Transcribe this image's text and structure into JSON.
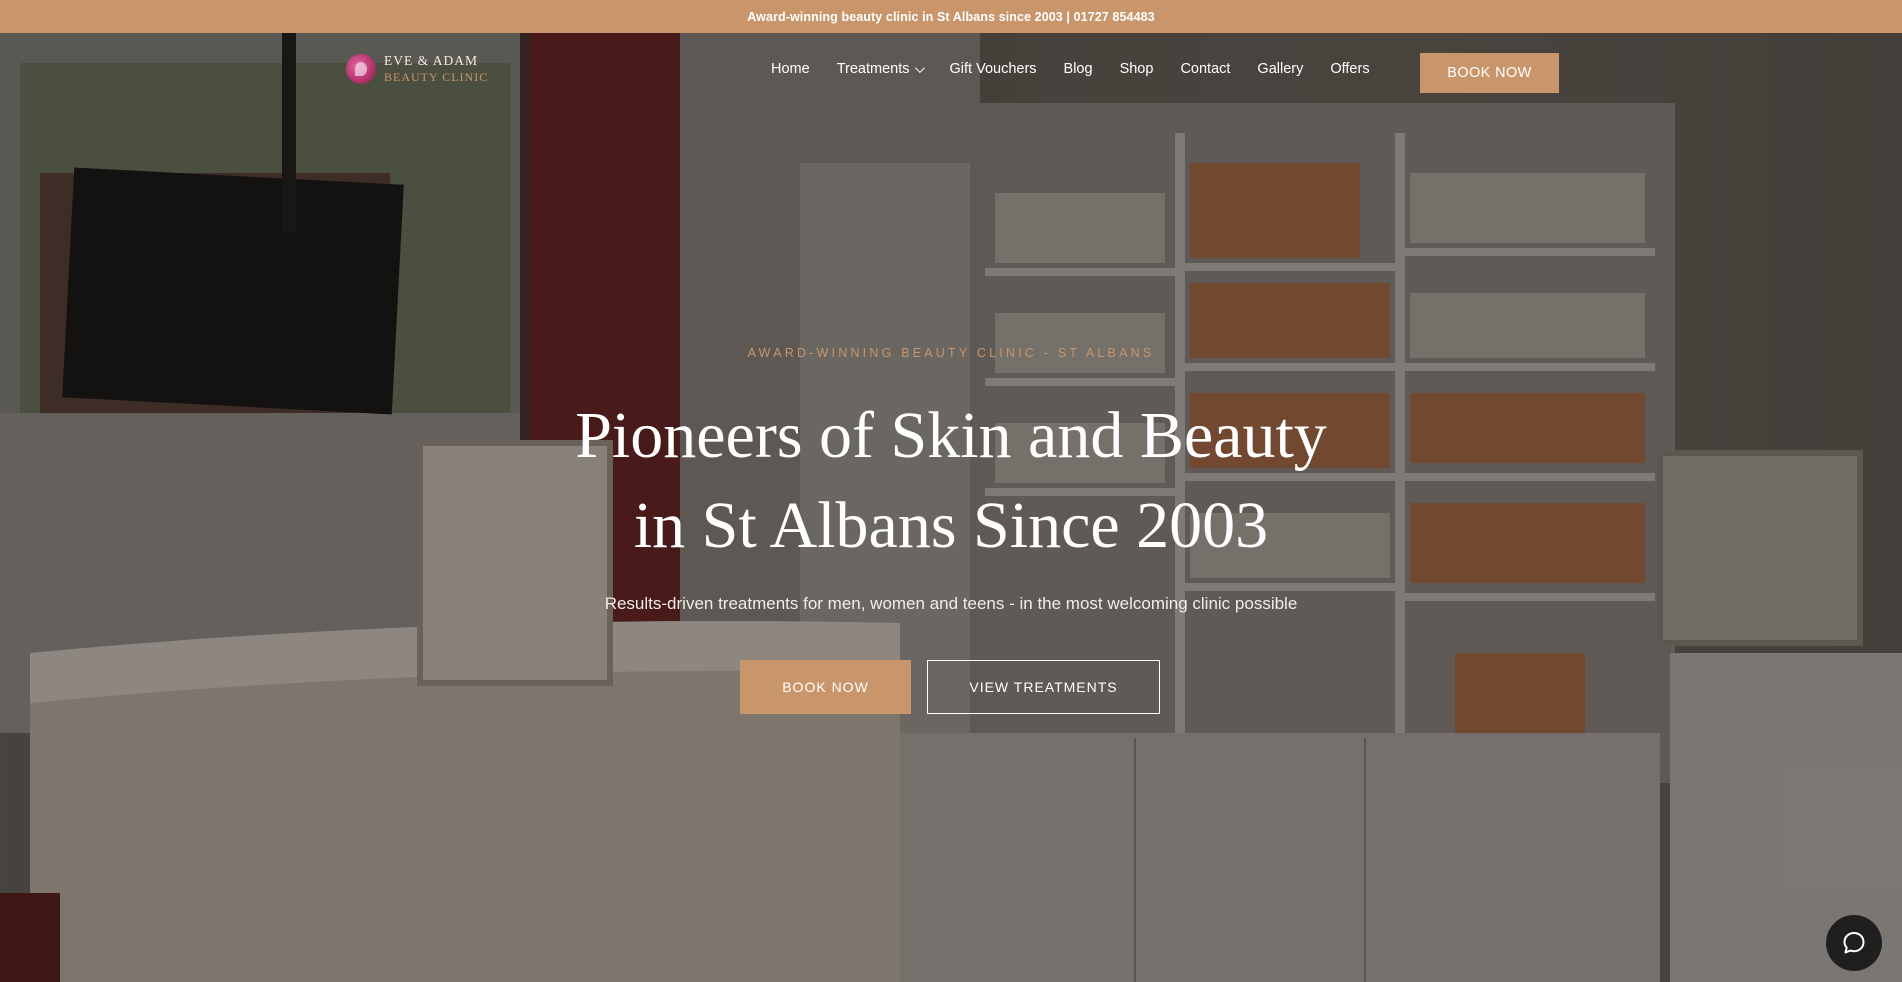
{
  "announcement": {
    "text": "Award-winning beauty clinic in St Albans since 2003 | 01727 854483"
  },
  "brand": {
    "name_line1": "EVE & ADAM",
    "name_line2": "BEAUTY CLINIC",
    "accent_color": "#c9956a"
  },
  "nav": {
    "items": [
      {
        "label": "Home"
      },
      {
        "label": "Treatments",
        "has_dropdown": true
      },
      {
        "label": "Gift Vouchers"
      },
      {
        "label": "Blog"
      },
      {
        "label": "Shop"
      },
      {
        "label": "Contact"
      },
      {
        "label": "Gallery"
      },
      {
        "label": "Offers"
      }
    ],
    "cta_label": "BOOK NOW"
  },
  "hero": {
    "eyebrow": "AWARD-WINNING BEAUTY CLINIC - ST ALBANS",
    "headline_line1": "Pioneers of Skin and Beauty",
    "headline_line2": "in St Albans Since 2003",
    "subline": "Results-driven treatments for men, women and teens - in the most welcoming clinic possible",
    "primary_button": "BOOK NOW",
    "secondary_button": "VIEW TREATMENTS"
  },
  "icons": {
    "chat": "chat-bubble-icon",
    "dropdown": "chevron-down-icon",
    "logo": "logo-mark-icon"
  }
}
